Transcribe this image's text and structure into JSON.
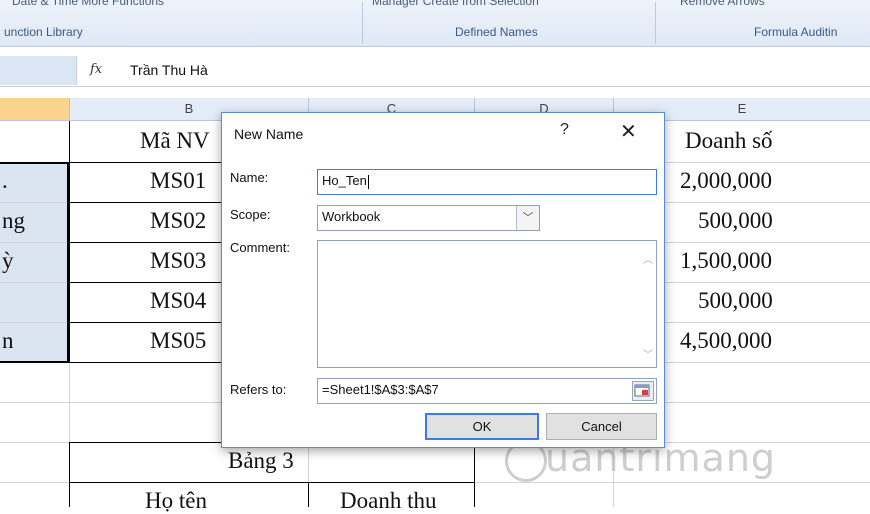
{
  "ribbon": {
    "cut_top_left": "Date & Time   More Functions",
    "cut_top_middle": "Manager   Create from Selection",
    "cut_top_right": "Remove Arrows",
    "group_function_library": "unction Library",
    "group_defined_names": "Defined Names",
    "group_formula_auditing": "Formula Auditin"
  },
  "formula_bar": {
    "fx_symbol": "fx",
    "content": "Trần Thu Hà"
  },
  "columns": [
    "B",
    "C",
    "D",
    "E"
  ],
  "sheet": {
    "col_b": [
      "Mã NV",
      "MS01",
      "MS02",
      "MS03",
      "MS04",
      "MS05"
    ],
    "col_a_partial": [
      ".",
      "ng",
      "ỳ",
      "",
      "n"
    ],
    "col_e": [
      "Doanh số",
      "2,000,000",
      "500,000",
      "1,500,000",
      "500,000",
      "4,500,000"
    ],
    "bang3_title": "Bảng 3",
    "bang3_headers": [
      "Họ tên",
      "Doanh thu"
    ]
  },
  "dialog": {
    "title": "New Name",
    "help": "?",
    "close": "✕",
    "name_label": "Name:",
    "name_value": "Ho_Ten",
    "scope_label": "Scope:",
    "scope_value": "Workbook",
    "comment_label": "Comment:",
    "comment_value": "",
    "refers_label": "Refers to:",
    "refers_value": "=Sheet1!$A$3:$A$7",
    "ok_label": "OK",
    "cancel_label": "Cancel"
  },
  "watermark": "uantrimang"
}
